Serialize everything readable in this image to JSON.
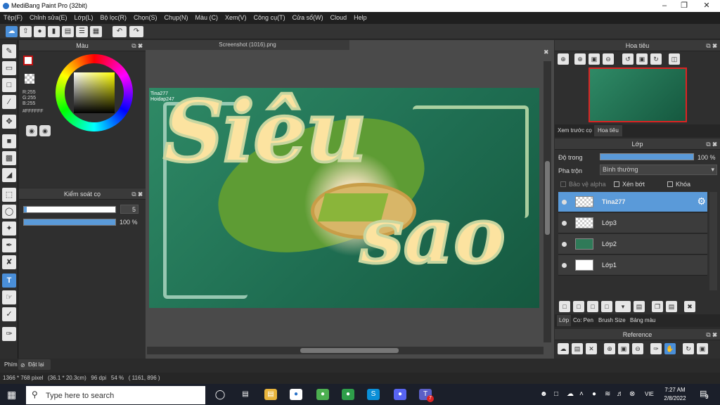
{
  "window": {
    "title": "MediBang Paint Pro (32bit)",
    "minimize_icon": "minimize-icon",
    "maximize_icon": "maximize-icon",
    "close_icon": "close-icon"
  },
  "menu": [
    "Tệp(F)",
    "Chỉnh sửa(E)",
    "Lớp(L)",
    "Bộ lọc(R)",
    "Chọn(S)",
    "Chụp(N)",
    "Màu (C)",
    "Xem(V)",
    "Công cụ(T)",
    "Cửa sổ(W)",
    "Cloud",
    "Help"
  ],
  "color_panel": {
    "title": "Màu",
    "r": "R:255",
    "g": "G:255",
    "b": "B:255",
    "hex": "#FFFFFF",
    "primary": "#ffffff",
    "secondary": "#c01010"
  },
  "brush_panel": {
    "title": "Kiểm soát cọ",
    "size": "5",
    "opacity": "100 %",
    "size_fraction": 0.03,
    "opacity_fraction": 1.0
  },
  "document": {
    "tab": "Screenshot (1016).png",
    "watermark_line1": "Tina277",
    "watermark_line2": "Hoidap247",
    "art_text1": "Siêu",
    "art_text2": "sao"
  },
  "navigator": {
    "title": "Hoa tiêu",
    "tab_preview": "Xem trước cọ",
    "tab_nav": "Hoa tiêu"
  },
  "layers": {
    "title": "Lớp",
    "opacity_label": "Độ trong",
    "opacity_value": "100 %",
    "blend_label": "Pha trộn",
    "blend_value": "Bình thường",
    "protect_alpha": "Bảo vệ alpha",
    "clip": "Xén bớt",
    "lock": "Khóa",
    "items": [
      {
        "name": "Tina277"
      },
      {
        "name": "Lớp3"
      },
      {
        "name": "Lớp2"
      },
      {
        "name": "Lớp1"
      }
    ],
    "bottom_tabs": [
      "Lớp",
      "Co: Pen",
      "Brush Size",
      "Bảng màu"
    ]
  },
  "reference": {
    "title": "Reference"
  },
  "bottom_left": {
    "tab": "Phím",
    "reset": "Đặt lại"
  },
  "status": {
    "text": "1366 * 768 pixel   (36.1 * 20.3cm)   96 dpi   54 %   ( 1161, 896 )"
  },
  "taskbar": {
    "search_placeholder": "Type here to search",
    "lang": "VIE",
    "time": "7:27 AM",
    "date": "2/8/2022",
    "notif_count": "9",
    "teams_badge": "7"
  }
}
